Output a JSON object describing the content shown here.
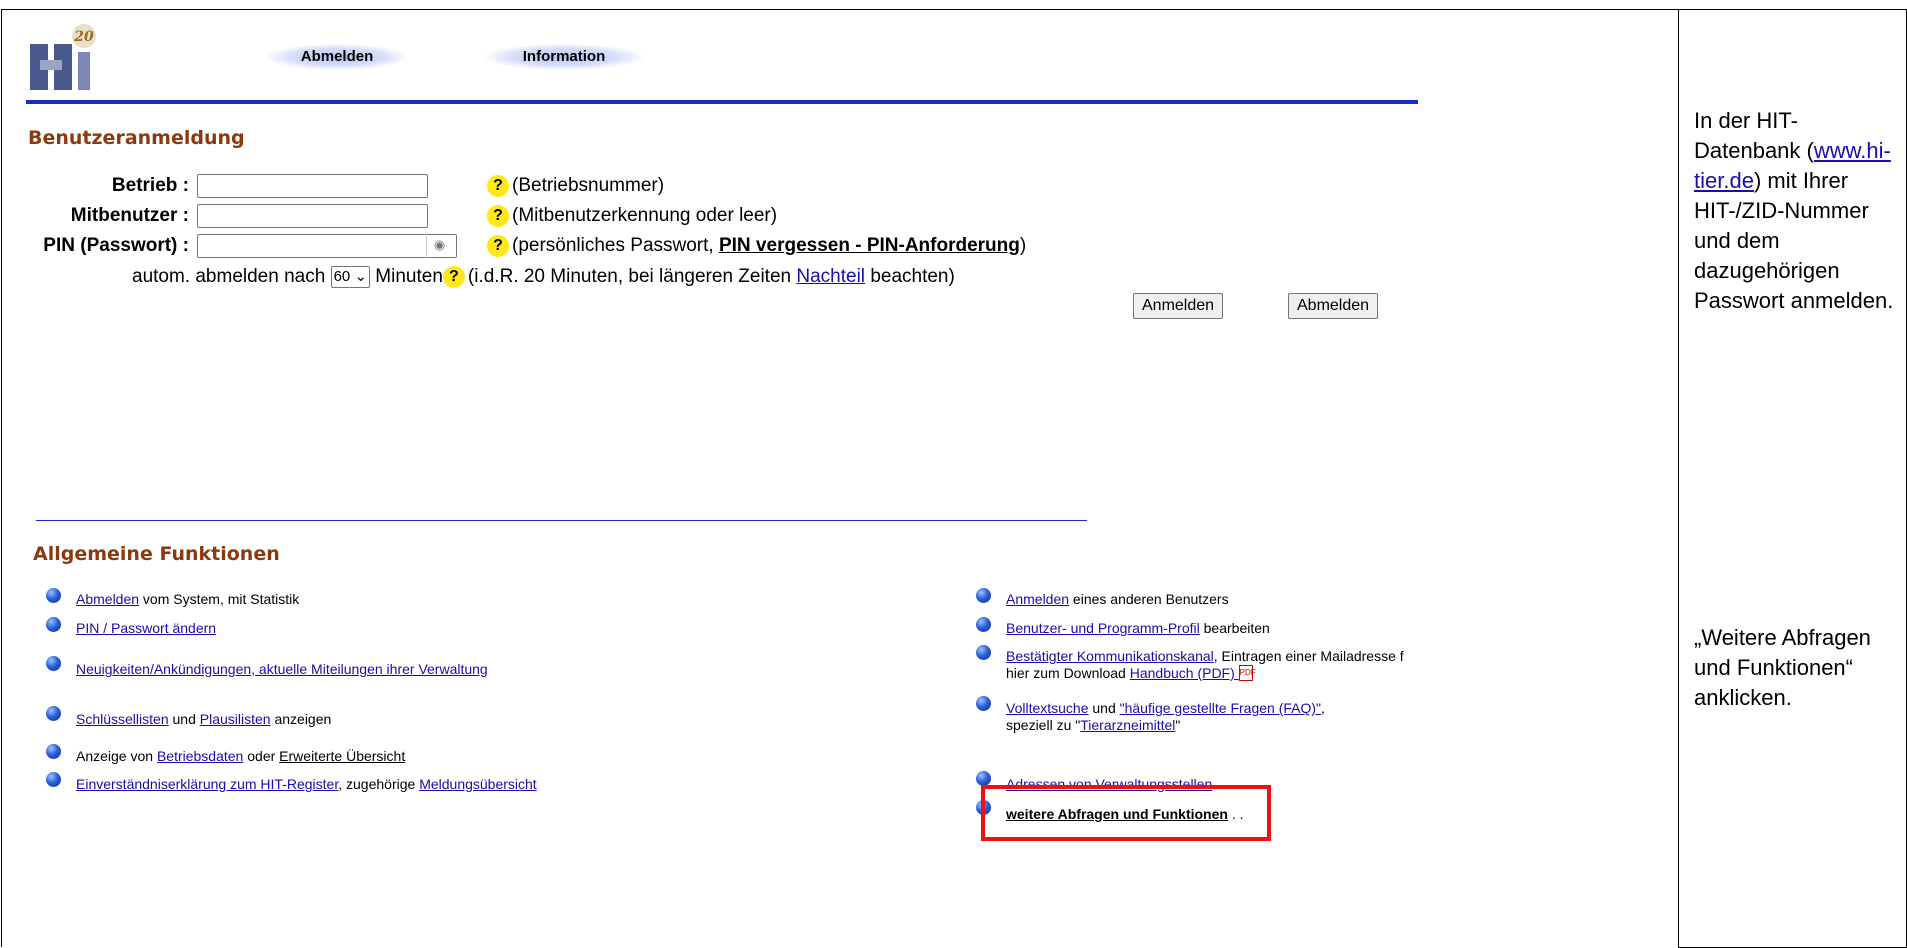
{
  "header": {
    "logo_text": "HI",
    "logo_badge": "20",
    "logout_label": "Abmelden",
    "info_label": "Information"
  },
  "login": {
    "title": "Benutzeranmeldung",
    "betrieb_label": "Betrieb :",
    "betrieb_value": "",
    "betrieb_help": "(Betriebsnummer)",
    "mitbenutzer_label": "Mitbenutzer :",
    "mitbenutzer_value": "",
    "mitbenutzer_help": "(Mitbenutzerkennung oder leer)",
    "pin_label": "PIN (Passwort) :",
    "pin_value": "",
    "pin_help_pre": "(persönliches Passwort,",
    "pin_help_link": "PIN vergessen - PIN-Anforderung",
    "pin_help_post": ")",
    "timeout_pre": "autom. abmelden nach",
    "timeout_value": "60",
    "timeout_post": "Minuten",
    "timeout_help_pre": "(i.d.R. 20 Minuten, bei längeren Zeiten",
    "timeout_help_link": "Nachteil",
    "timeout_help_post": "beachten)",
    "help_icon": "?",
    "login_button": "Anmelden",
    "logout_button": "Abmelden"
  },
  "functions": {
    "title": "Allgemeine Funktionen",
    "left": [
      {
        "link": "Abmelden",
        "text": " vom System, mit Statistik"
      },
      {
        "link": "PIN / Passwort ändern",
        "text": ""
      },
      {
        "link": "Neuigkeiten/Ankündigungen, aktuelle Miteilungen ihrer Verwaltung",
        "text": ""
      },
      {
        "link": "Schlüssellisten",
        "mid": " und ",
        "link2": "Plausilisten",
        "text": " anzeigen"
      },
      {
        "pre": "Anzeige von ",
        "link": "Betriebsdaten",
        "mid": " oder ",
        "link2": "Erweiterte Übersicht"
      },
      {
        "link": "Einverständniserklärung zum HIT-Register",
        "mid": ", zugehörige ",
        "link2": "Meldungsübersicht"
      }
    ],
    "right": [
      {
        "link": "Anmelden",
        "text": " eines anderen Benutzers"
      },
      {
        "link": "Benutzer- und Programm-Profil",
        "text": " bearbeiten"
      },
      {
        "link": "Bestätigter Kommunikationskanal",
        "text": ", Eintragen einer Mailadresse f",
        "line2_pre": "hier zum Download ",
        "line2_link": "Handbuch (PDF) "
      },
      {
        "link": "Volltextsuche",
        "mid": " und ",
        "link2": "\"häufige gestellte Fragen (FAQ)\"",
        "text": ",",
        "line2_pre": "speziell zu \"",
        "line2_link": "Tierarzneimittel",
        "line2_post": "\""
      },
      {
        "link": "Adressen von Verwaltungsstellen"
      },
      {
        "link": "weitere Abfragen und Funktionen",
        "text": " . ."
      }
    ]
  },
  "side": {
    "text1_pre": "In der HIT-Datenbank (",
    "text1_link": "www.hi-tier.de",
    "text1_post": ") mit Ihrer HIT-/ZID-Nummer und dem dazugehörigen Passwort anmelden.",
    "text2": "„Weitere Abfragen und Funktionen“ anklicken."
  },
  "colors": {
    "accent_blue": "#1b2bc8",
    "section_title": "#8b3a10",
    "highlight_red": "#f01010",
    "help_yellow": "#ffe816"
  }
}
